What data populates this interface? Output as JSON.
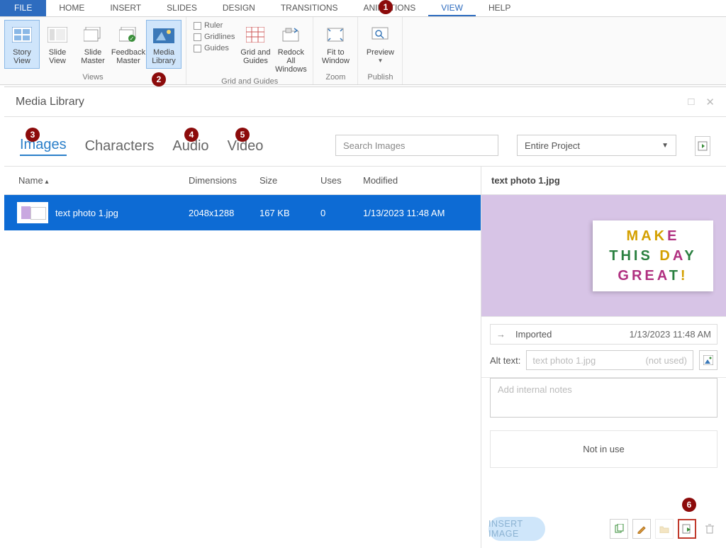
{
  "ribbon": {
    "tabs": [
      "FILE",
      "HOME",
      "INSERT",
      "SLIDES",
      "DESIGN",
      "TRANSITIONS",
      "ANIMATIONS",
      "VIEW",
      "HELP"
    ],
    "active_tab": "VIEW",
    "views_group": "Views",
    "grid_group": "Grid and Guides",
    "zoom_group": "Zoom",
    "publish_group": "Publish",
    "btn_story_view": "Story View",
    "btn_slide_view": "Slide View",
    "btn_slide_master": "Slide Master",
    "btn_feedback_master": "Feedback Master",
    "btn_media_library": "Media Library",
    "chk_ruler": "Ruler",
    "chk_gridlines": "Gridlines",
    "chk_guides": "Guides",
    "btn_grid_guides": "Grid and Guides",
    "btn_redock": "Redock All Windows",
    "btn_fit": "Fit to Window",
    "btn_preview": "Preview"
  },
  "panel": {
    "title": "Media Library",
    "tabs": {
      "images": "Images",
      "characters": "Characters",
      "audio": "Audio",
      "video": "Video"
    },
    "search_placeholder": "Search Images",
    "scope": "Entire Project",
    "cols": {
      "name": "Name",
      "dim": "Dimensions",
      "size": "Size",
      "uses": "Uses",
      "mod": "Modified"
    },
    "row": {
      "name": "text photo 1.jpg",
      "dim": "2048x1288",
      "size": "167 KB",
      "uses": "0",
      "mod": "1/13/2023 11:48 AM"
    }
  },
  "preview": {
    "title": "text photo 1.jpg",
    "lightbox_l1": "MAKE",
    "lightbox_l2": "THIS DAY",
    "lightbox_l3": "GREAT!",
    "imported_label": "Imported",
    "imported_date": "1/13/2023 11:48 AM",
    "alt_label": "Alt text:",
    "alt_value": "text photo 1.jpg",
    "alt_status": "(not used)",
    "notes_placeholder": "Add internal notes",
    "usage": "Not in use",
    "insert": "INSERT IMAGE"
  },
  "badges": [
    "1",
    "2",
    "3",
    "4",
    "5",
    "6"
  ]
}
